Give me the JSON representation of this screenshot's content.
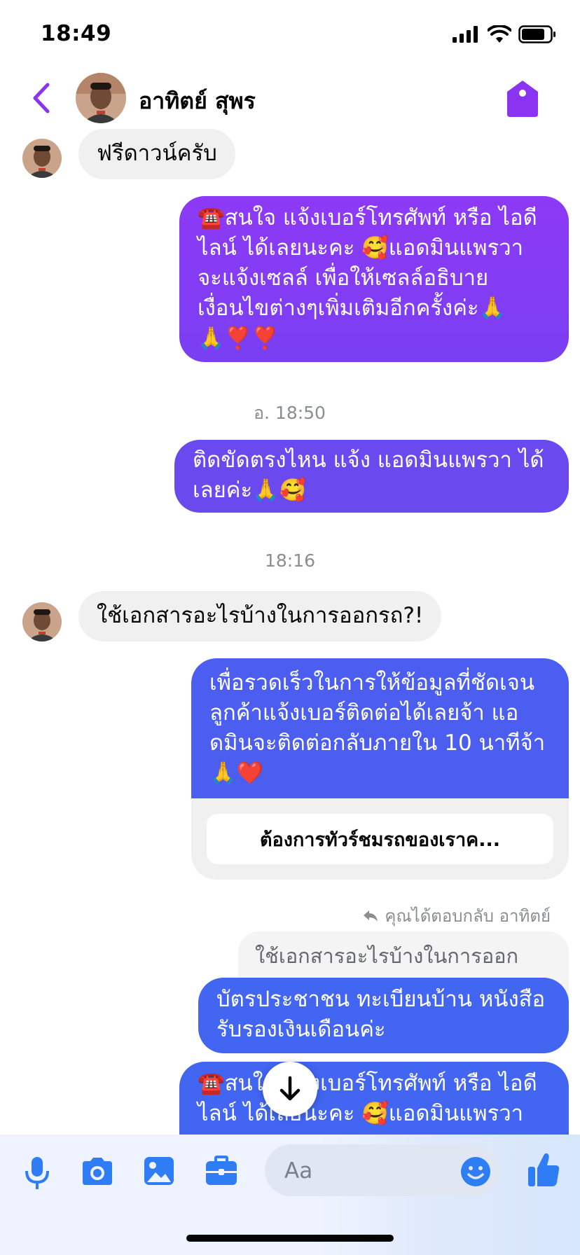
{
  "status_bar": {
    "time": "18:49"
  },
  "header": {
    "contact_name": "อาทิตย์ สุพร"
  },
  "messages": [
    {
      "text": "ฟรีดาวน์ครับ"
    },
    {
      "text": "☎️สนใจ แจ้งเบอร์โทรศัพท์ หรือ ไอดีไลน์  ได้เลยนะคะ 🥰แอดมินแพรวาจะแจ้งเซลล์     เพื่อให้เซลล์อธิบายเงื่อนไขต่างๆเพิ่มเติมอีกครั้งค่ะ🙏🙏❣️❣️"
    },
    {
      "text": "ติดขัดตรงไหน แจ้ง แอดมินแพรวา ได้เลยค่ะ🙏🥰"
    },
    {
      "text": "ใช้เอกสารอะไรบ้างในการออกรถ?!"
    },
    {
      "text": "เพื่อรวดเร็วในการให้ข้อมูลที่ชัดเจน ลูกค้าแจ้งเบอร์ติดต่อได้เลยจ้า แอดมินจะติดต่อกลับภายใน 10 นาทีจ้า🙏❤️",
      "button": "ต้องการทัวร์ชมรถของเราค..."
    },
    {
      "text": "บัตรประชาชน ทะเบียนบ้าน หนังสือรับรองเงินเดือนค่ะ"
    },
    {
      "text": "☎️สนใจ แจ้งเบอร์โทรศัพท์ หรือ ไอดีไลน์  ได้เลยนะคะ 🥰แอดมินแพรวา"
    }
  ],
  "timestamps": [
    "อ. 18:50",
    "18:16"
  ],
  "reply": {
    "note": "คุณได้ตอบกลับ อาทิตย์",
    "quoted": "ใช้เอกสารอะไรบ้างในการออกรถ?!"
  },
  "composer": {
    "placeholder": "Aa"
  },
  "colors": {
    "accent": "#8a33f0",
    "bubble_purple_top": "#8d39f5",
    "bubble_purple_bottom": "#7a3ff2",
    "bubble_indigo": "#6a49ee",
    "bubble_blue": "#4b5ef0",
    "bubble_blue2": "#4265f2",
    "incoming_bubble": "#f0f0f0",
    "composer_icon": "#2f7df5"
  },
  "icons": [
    "back-chevron-icon",
    "tag-icon",
    "microphone-icon",
    "camera-icon",
    "image-icon",
    "briefcase-icon",
    "emoji-icon",
    "thumbs-up-icon",
    "arrow-down-icon",
    "reply-arrow-icon"
  ]
}
